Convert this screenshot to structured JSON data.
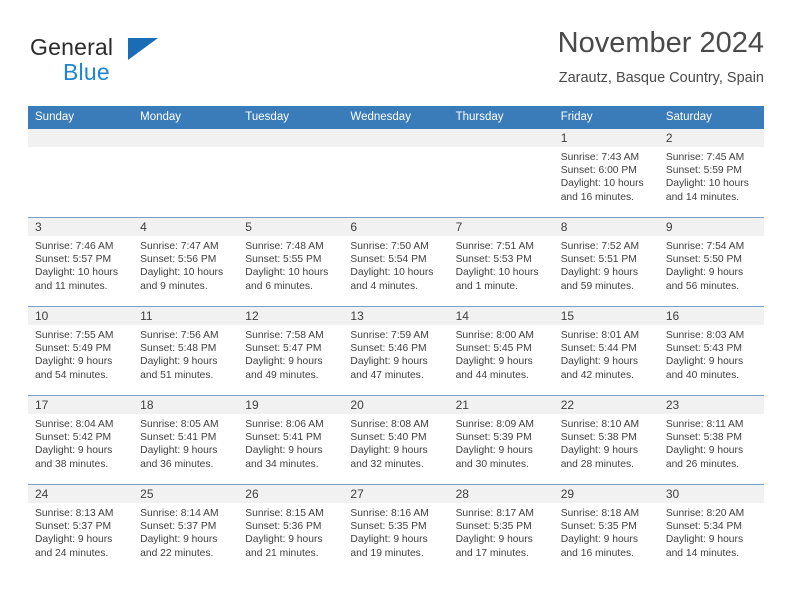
{
  "brand": {
    "name_part1": "General",
    "name_part2": "Blue",
    "logo_icon": "triangle-icon",
    "accent_color": "#1d84d6"
  },
  "header": {
    "title": "November 2024",
    "subtitle": "Zarautz, Basque Country, Spain"
  },
  "calendar": {
    "header_color": "#3a7cba",
    "weekday_headers": [
      "Sunday",
      "Monday",
      "Tuesday",
      "Wednesday",
      "Thursday",
      "Friday",
      "Saturday"
    ],
    "weeks": [
      [
        {
          "day": "",
          "lines": []
        },
        {
          "day": "",
          "lines": []
        },
        {
          "day": "",
          "lines": []
        },
        {
          "day": "",
          "lines": []
        },
        {
          "day": "",
          "lines": []
        },
        {
          "day": "1",
          "lines": [
            "Sunrise: 7:43 AM",
            "Sunset: 6:00 PM",
            "Daylight: 10 hours",
            "and 16 minutes."
          ]
        },
        {
          "day": "2",
          "lines": [
            "Sunrise: 7:45 AM",
            "Sunset: 5:59 PM",
            "Daylight: 10 hours",
            "and 14 minutes."
          ]
        }
      ],
      [
        {
          "day": "3",
          "lines": [
            "Sunrise: 7:46 AM",
            "Sunset: 5:57 PM",
            "Daylight: 10 hours",
            "and 11 minutes."
          ]
        },
        {
          "day": "4",
          "lines": [
            "Sunrise: 7:47 AM",
            "Sunset: 5:56 PM",
            "Daylight: 10 hours",
            "and 9 minutes."
          ]
        },
        {
          "day": "5",
          "lines": [
            "Sunrise: 7:48 AM",
            "Sunset: 5:55 PM",
            "Daylight: 10 hours",
            "and 6 minutes."
          ]
        },
        {
          "day": "6",
          "lines": [
            "Sunrise: 7:50 AM",
            "Sunset: 5:54 PM",
            "Daylight: 10 hours",
            "and 4 minutes."
          ]
        },
        {
          "day": "7",
          "lines": [
            "Sunrise: 7:51 AM",
            "Sunset: 5:53 PM",
            "Daylight: 10 hours",
            "and 1 minute."
          ]
        },
        {
          "day": "8",
          "lines": [
            "Sunrise: 7:52 AM",
            "Sunset: 5:51 PM",
            "Daylight: 9 hours",
            "and 59 minutes."
          ]
        },
        {
          "day": "9",
          "lines": [
            "Sunrise: 7:54 AM",
            "Sunset: 5:50 PM",
            "Daylight: 9 hours",
            "and 56 minutes."
          ]
        }
      ],
      [
        {
          "day": "10",
          "lines": [
            "Sunrise: 7:55 AM",
            "Sunset: 5:49 PM",
            "Daylight: 9 hours",
            "and 54 minutes."
          ]
        },
        {
          "day": "11",
          "lines": [
            "Sunrise: 7:56 AM",
            "Sunset: 5:48 PM",
            "Daylight: 9 hours",
            "and 51 minutes."
          ]
        },
        {
          "day": "12",
          "lines": [
            "Sunrise: 7:58 AM",
            "Sunset: 5:47 PM",
            "Daylight: 9 hours",
            "and 49 minutes."
          ]
        },
        {
          "day": "13",
          "lines": [
            "Sunrise: 7:59 AM",
            "Sunset: 5:46 PM",
            "Daylight: 9 hours",
            "and 47 minutes."
          ]
        },
        {
          "day": "14",
          "lines": [
            "Sunrise: 8:00 AM",
            "Sunset: 5:45 PM",
            "Daylight: 9 hours",
            "and 44 minutes."
          ]
        },
        {
          "day": "15",
          "lines": [
            "Sunrise: 8:01 AM",
            "Sunset: 5:44 PM",
            "Daylight: 9 hours",
            "and 42 minutes."
          ]
        },
        {
          "day": "16",
          "lines": [
            "Sunrise: 8:03 AM",
            "Sunset: 5:43 PM",
            "Daylight: 9 hours",
            "and 40 minutes."
          ]
        }
      ],
      [
        {
          "day": "17",
          "lines": [
            "Sunrise: 8:04 AM",
            "Sunset: 5:42 PM",
            "Daylight: 9 hours",
            "and 38 minutes."
          ]
        },
        {
          "day": "18",
          "lines": [
            "Sunrise: 8:05 AM",
            "Sunset: 5:41 PM",
            "Daylight: 9 hours",
            "and 36 minutes."
          ]
        },
        {
          "day": "19",
          "lines": [
            "Sunrise: 8:06 AM",
            "Sunset: 5:41 PM",
            "Daylight: 9 hours",
            "and 34 minutes."
          ]
        },
        {
          "day": "20",
          "lines": [
            "Sunrise: 8:08 AM",
            "Sunset: 5:40 PM",
            "Daylight: 9 hours",
            "and 32 minutes."
          ]
        },
        {
          "day": "21",
          "lines": [
            "Sunrise: 8:09 AM",
            "Sunset: 5:39 PM",
            "Daylight: 9 hours",
            "and 30 minutes."
          ]
        },
        {
          "day": "22",
          "lines": [
            "Sunrise: 8:10 AM",
            "Sunset: 5:38 PM",
            "Daylight: 9 hours",
            "and 28 minutes."
          ]
        },
        {
          "day": "23",
          "lines": [
            "Sunrise: 8:11 AM",
            "Sunset: 5:38 PM",
            "Daylight: 9 hours",
            "and 26 minutes."
          ]
        }
      ],
      [
        {
          "day": "24",
          "lines": [
            "Sunrise: 8:13 AM",
            "Sunset: 5:37 PM",
            "Daylight: 9 hours",
            "and 24 minutes."
          ]
        },
        {
          "day": "25",
          "lines": [
            "Sunrise: 8:14 AM",
            "Sunset: 5:37 PM",
            "Daylight: 9 hours",
            "and 22 minutes."
          ]
        },
        {
          "day": "26",
          "lines": [
            "Sunrise: 8:15 AM",
            "Sunset: 5:36 PM",
            "Daylight: 9 hours",
            "and 21 minutes."
          ]
        },
        {
          "day": "27",
          "lines": [
            "Sunrise: 8:16 AM",
            "Sunset: 5:35 PM",
            "Daylight: 9 hours",
            "and 19 minutes."
          ]
        },
        {
          "day": "28",
          "lines": [
            "Sunrise: 8:17 AM",
            "Sunset: 5:35 PM",
            "Daylight: 9 hours",
            "and 17 minutes."
          ]
        },
        {
          "day": "29",
          "lines": [
            "Sunrise: 8:18 AM",
            "Sunset: 5:35 PM",
            "Daylight: 9 hours",
            "and 16 minutes."
          ]
        },
        {
          "day": "30",
          "lines": [
            "Sunrise: 8:20 AM",
            "Sunset: 5:34 PM",
            "Daylight: 9 hours",
            "and 14 minutes."
          ]
        }
      ]
    ]
  }
}
